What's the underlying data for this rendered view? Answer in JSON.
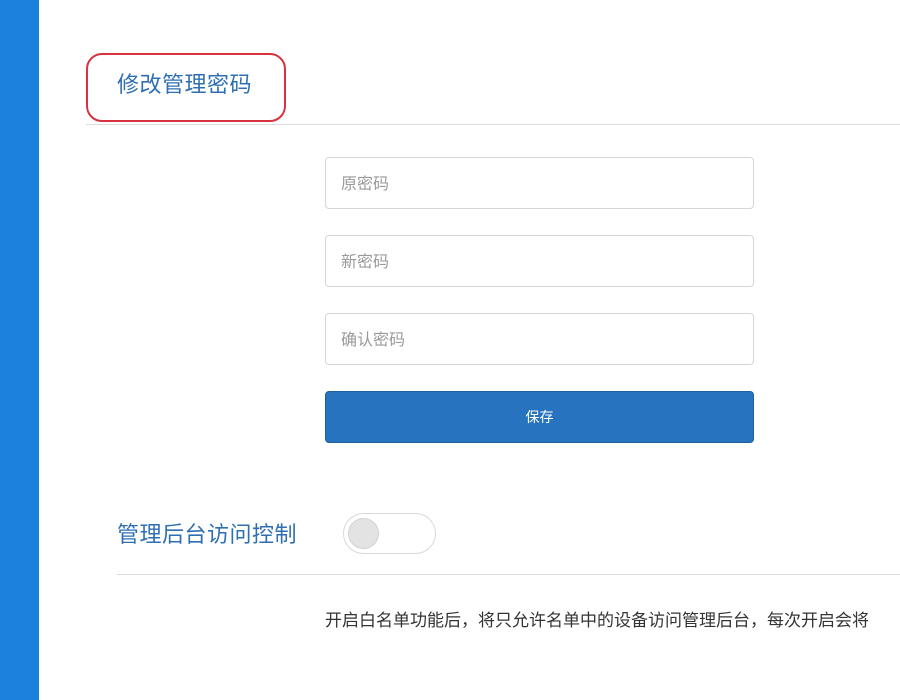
{
  "password_section": {
    "title": "修改管理密码",
    "old_password_placeholder": "原密码",
    "new_password_placeholder": "新密码",
    "confirm_password_placeholder": "确认密码",
    "save_label": "保存"
  },
  "access_control": {
    "title": "管理后台访问控制",
    "toggle_on": false,
    "description": "开启白名单功能后，将只允许名单中的设备访问管理后台，每次开启会将"
  },
  "colors": {
    "sidebar": "#1a82dc",
    "accent": "#2873c0",
    "title_text": "#2f6fb1",
    "highlight_border": "#d8323f"
  }
}
